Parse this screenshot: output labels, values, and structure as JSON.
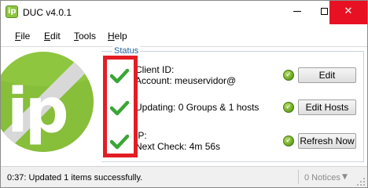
{
  "window": {
    "title": "DUC v4.0.1"
  },
  "menu": [
    {
      "label": "File",
      "mnemonic": "F",
      "rest": "ile"
    },
    {
      "label": "Edit",
      "mnemonic": "E",
      "rest": "dit"
    },
    {
      "label": "Tools",
      "mnemonic": "T",
      "rest": "ools"
    },
    {
      "label": "Help",
      "mnemonic": "H",
      "rest": "elp"
    }
  ],
  "status": {
    "legend": "Status",
    "rows": [
      {
        "line1": "Client ID:",
        "line2": "Account: meuservidor@",
        "button": "Edit",
        "icon": "check-icon"
      },
      {
        "line1": "Updating: 0 Groups & 1 hosts",
        "line2": "",
        "button": "Edit Hosts",
        "icon": "check-icon"
      },
      {
        "line1": "IP:",
        "line2": "Next Check: 4m 56s",
        "button": "Refresh Now",
        "icon": "check-icon"
      }
    ]
  },
  "statusbar": {
    "message": "0:37: Updated 1 items successfully.",
    "notices": "0 Notices"
  },
  "colors": {
    "highlight_box": "#e31d24",
    "check_green": "#3aa635",
    "logo_green": "#8ec63f",
    "close_red": "#e81123"
  }
}
